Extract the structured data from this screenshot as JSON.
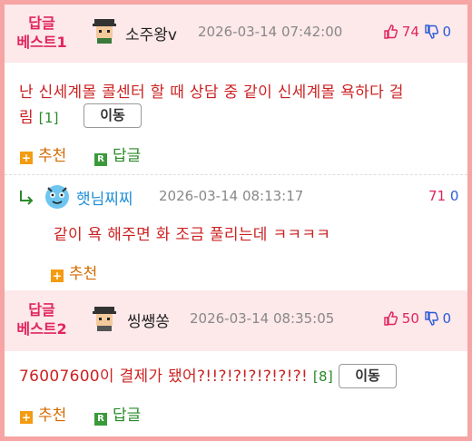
{
  "comments": [
    {
      "badge_line1": "답글",
      "badge_line2": "베스트1",
      "nickname": "소주왕v",
      "date": "2026-03-14 07:42:00",
      "upvotes": "74",
      "downvotes": "0",
      "text_line1": "난 신세계몰 콜센터 할 때 상담 중 같이 신세계몰 욕하다 걸",
      "text_line2": "림",
      "reply_count": "[1]",
      "move_label": "이동",
      "recommend_label": "추천",
      "reply_label": "답글"
    },
    {
      "nickname": "햇님찌찌",
      "date": "2026-03-14 08:13:17",
      "upvotes": "71",
      "downvotes": "0",
      "text": "같이 욕 해주면 화 조금 풀리는데 ㅋㅋㅋㅋ",
      "recommend_label": "추천"
    },
    {
      "badge_line1": "답글",
      "badge_line2": "베스트2",
      "nickname": "씽쌩쏭",
      "date": "2026-03-14 08:35:05",
      "upvotes": "50",
      "downvotes": "0",
      "text": "76007600이 결제가 됐어?!!?!?!?!?!?!?!",
      "reply_count": "[8]",
      "move_label": "이동",
      "recommend_label": "추천",
      "reply_label": "답글"
    }
  ],
  "colors": {
    "border": "#f6a4a4",
    "header_bg": "#fde8ea",
    "badge": "#e0245e",
    "text_red": "#cc2222",
    "up": "#e0245e",
    "down": "#2a5bd7",
    "nick_blue": "#1e8fd6"
  },
  "icons": {
    "up": "thumbs-up-icon",
    "down": "thumbs-down-icon",
    "reply_arrow": "reply-arrow-icon",
    "recommend": "plus-box-icon",
    "reply": "r-box-icon"
  }
}
